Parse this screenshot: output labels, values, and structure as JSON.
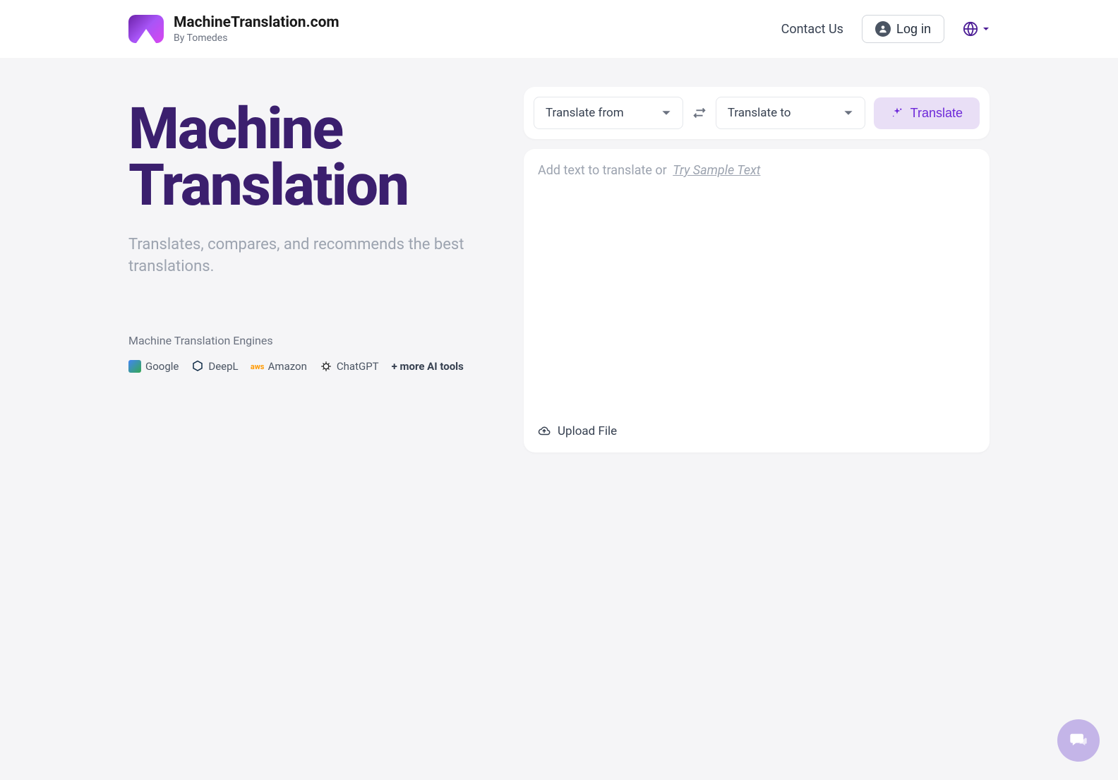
{
  "header": {
    "brand_title": "MachineTranslation.com",
    "brand_sub": "By Tomedes",
    "contact": "Contact Us",
    "login": "Log in"
  },
  "hero": {
    "title_line1": "Machine",
    "title_line2": "Translation",
    "subtitle": "Translates, compares, and recommends the best translations."
  },
  "engines": {
    "label": "Machine Translation Engines",
    "items": [
      "Google",
      "DeepL",
      "Amazon",
      "ChatGPT"
    ],
    "more": "+ more AI tools"
  },
  "controls": {
    "from_label": "Translate from",
    "to_label": "Translate to",
    "translate_btn": "Translate"
  },
  "panel": {
    "placeholder": "Add text to translate or ",
    "sample_link": "Try Sample Text",
    "upload": "Upload File"
  }
}
